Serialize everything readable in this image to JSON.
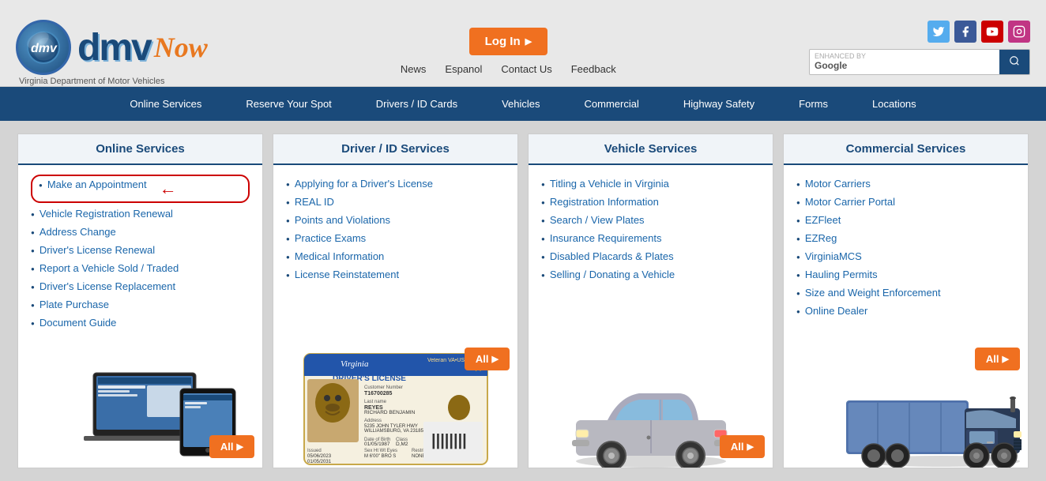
{
  "header": {
    "logo_dmv": "dmv",
    "logo_now": "Now",
    "subtitle": "Virginia Department of Motor Vehicles",
    "login_label": "Log In",
    "search_enhanced": "ENHANCED BY",
    "search_google": "Google",
    "search_placeholder": "",
    "nav_links": [
      "News",
      "Espanol",
      "Contact Us",
      "Feedback"
    ]
  },
  "social": {
    "twitter": "t",
    "facebook": "f",
    "youtube": "▶",
    "instagram": "📷"
  },
  "nav": {
    "items": [
      "Online Services",
      "Reserve Your Spot",
      "Drivers / ID Cards",
      "Vehicles",
      "Commercial",
      "Highway Safety",
      "Forms",
      "Locations"
    ]
  },
  "panels": {
    "online_services": {
      "title": "Online Services",
      "items": [
        "Make an Appointment",
        "Vehicle Registration Renewal",
        "Address Change",
        "Driver's License Renewal",
        "Report a Vehicle Sold / Traded",
        "Driver's License Replacement",
        "Plate Purchase",
        "Document Guide"
      ],
      "all_label": "All"
    },
    "driver_id": {
      "title": "Driver / ID Services",
      "items": [
        "Applying for a Driver's License",
        "REAL ID",
        "Points and Violations",
        "Practice Exams",
        "Medical Information",
        "License Reinstatement"
      ],
      "all_label": "All"
    },
    "vehicle": {
      "title": "Vehicle Services",
      "items": [
        "Titling a Vehicle in Virginia",
        "Registration Information",
        "Search / View Plates",
        "Insurance Requirements",
        "Disabled Placards & Plates",
        "Selling / Donating a Vehicle"
      ],
      "all_label": "All"
    },
    "commercial": {
      "title": "Commercial Services",
      "items": [
        "Motor Carriers",
        "Motor Carrier Portal",
        "EZFleet",
        "EZReg",
        "VirginiaMCS",
        "Hauling Permits",
        "Size and Weight Enforcement",
        "Online Dealer"
      ],
      "all_label": "All"
    }
  }
}
